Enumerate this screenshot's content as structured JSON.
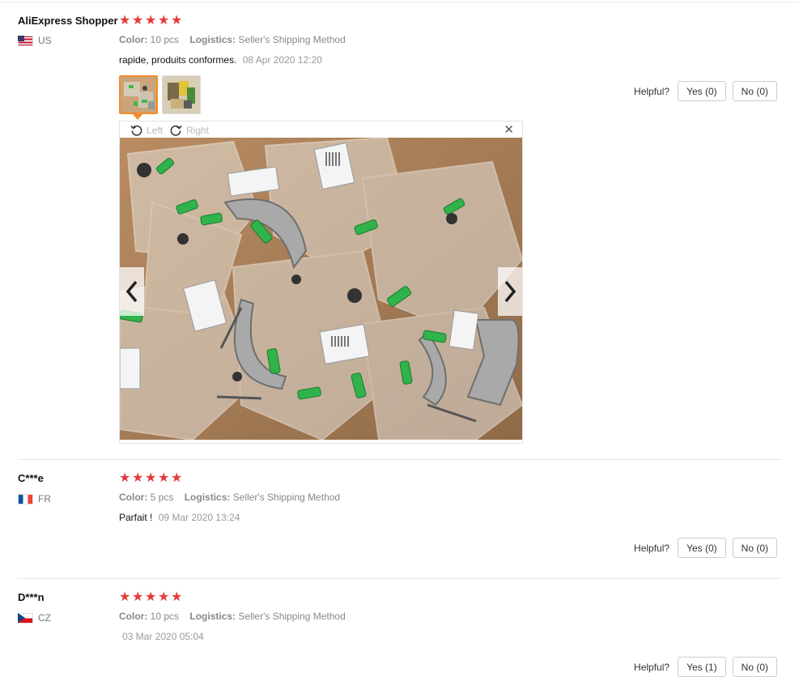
{
  "reviews": [
    {
      "name": "AliExpress Shopper",
      "country": "US",
      "rating": 5,
      "color_label": "Color:",
      "color_value": "10 pcs",
      "logistics_label": "Logistics:",
      "logistics_value": "Seller's Shipping Method",
      "text": "rapide, produits conformes.",
      "date": "08 Apr 2020 12:20",
      "helpful_label": "Helpful?",
      "yes_label": "Yes (0)",
      "no_label": "No (0)"
    },
    {
      "name": "C***e",
      "country": "FR",
      "rating": 5,
      "color_label": "Color:",
      "color_value": "5 pcs",
      "logistics_label": "Logistics:",
      "logistics_value": "Seller's Shipping Method",
      "text": "Parfait !",
      "date": "09 Mar 2020 13:24",
      "helpful_label": "Helpful?",
      "yes_label": "Yes (0)",
      "no_label": "No (0)"
    },
    {
      "name": "D***n",
      "country": "CZ",
      "rating": 5,
      "color_label": "Color:",
      "color_value": "10 pcs",
      "logistics_label": "Logistics:",
      "logistics_value": "Seller's Shipping Method",
      "text": "",
      "date": "03 Mar 2020 05:04",
      "helpful_label": "Helpful?",
      "yes_label": "Yes (1)",
      "no_label": "No (0)"
    }
  ],
  "viewer": {
    "rotate_left_label": "Left",
    "rotate_right_label": "Right",
    "close_icon": "close-icon",
    "prev_icon": "chevron-left-icon",
    "next_icon": "chevron-right-icon"
  },
  "colors": {
    "star": "#e4393c",
    "active_thumb": "#f28b2a"
  }
}
